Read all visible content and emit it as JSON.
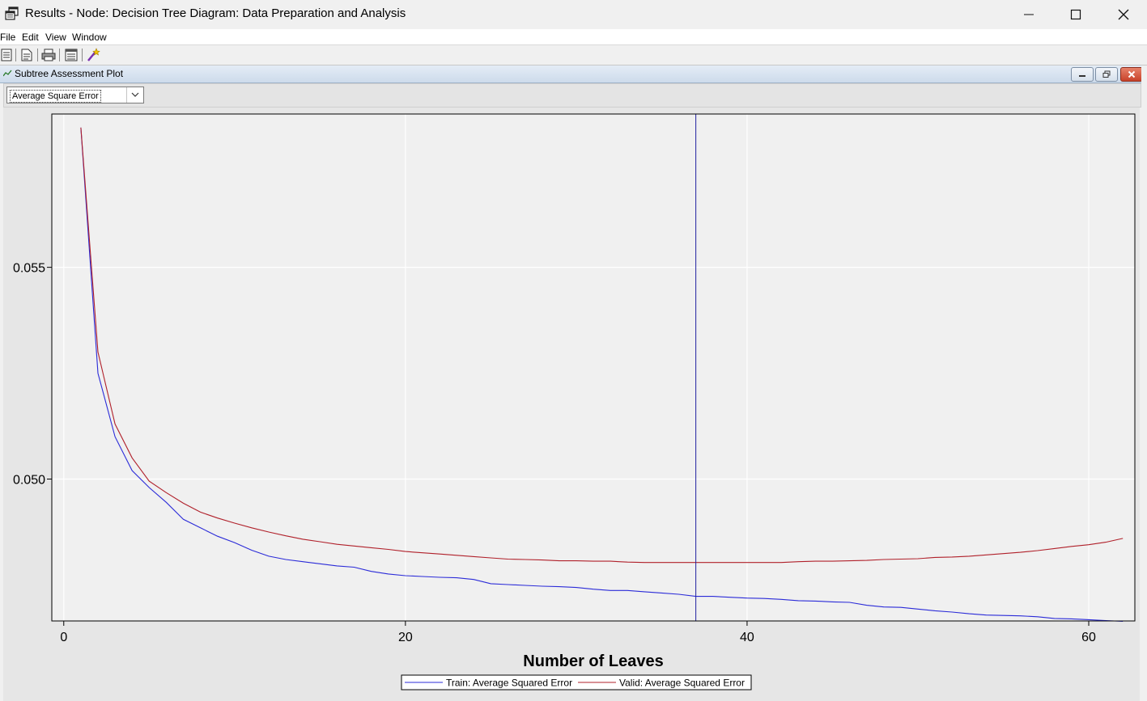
{
  "window": {
    "title": "Results - Node: Decision Tree  Diagram: Data Preparation and Analysis"
  },
  "menu": [
    "File",
    "Edit",
    "View",
    "Window"
  ],
  "toolbar": {
    "icons": [
      "document-icon",
      "report-icon",
      "print-icon",
      "table-icon",
      "wizard-icon"
    ]
  },
  "inner_window": {
    "title": "Subtree Assessment Plot"
  },
  "stat_selector": {
    "value": "Average Square Error"
  },
  "colors": {
    "train": "#2b2bd8",
    "valid": "#b0202a",
    "ref_line": "#2020a0",
    "plot_bg": "#f0f0f0"
  },
  "chart_data": {
    "type": "line",
    "xlabel": "Number of Leaves",
    "ylabel": "",
    "xlim": [
      -0.7,
      62.7
    ],
    "ylim": [
      0.04665,
      0.05862
    ],
    "xticks": [
      0,
      20,
      40,
      60
    ],
    "xtick_labels": [
      "0",
      "20",
      "40",
      "60"
    ],
    "yticks": [
      0.05,
      0.055
    ],
    "ytick_labels": [
      "0.050",
      "0.055"
    ],
    "grid": true,
    "selected_leaves": 37,
    "legend_position": "bottom-center",
    "series": [
      {
        "name": "Train: Average Squared Error",
        "color": "#2b2bd8",
        "x": [
          1,
          2,
          3,
          4,
          5,
          6,
          7,
          8,
          9,
          10,
          11,
          12,
          13,
          14,
          15,
          16,
          17,
          18,
          19,
          20,
          21,
          22,
          23,
          24,
          25,
          26,
          27,
          28,
          29,
          30,
          31,
          32,
          33,
          34,
          35,
          36,
          37,
          38,
          39,
          40,
          41,
          42,
          43,
          44,
          45,
          46,
          47,
          48,
          49,
          50,
          51,
          52,
          53,
          54,
          55,
          56,
          57,
          58,
          59,
          60,
          61,
          62
        ],
        "values": [
          0.0583,
          0.0525,
          0.051,
          0.0502,
          0.0498,
          0.04945,
          0.04905,
          0.04885,
          0.04865,
          0.0485,
          0.04832,
          0.04818,
          0.0481,
          0.04805,
          0.048,
          0.04795,
          0.04792,
          0.04782,
          0.04776,
          0.04772,
          0.0477,
          0.04768,
          0.04767,
          0.04763,
          0.04753,
          0.04751,
          0.04749,
          0.04747,
          0.04746,
          0.04744,
          0.0474,
          0.04737,
          0.04737,
          0.04734,
          0.04731,
          0.04728,
          0.04723,
          0.04723,
          0.04721,
          0.04719,
          0.04718,
          0.04716,
          0.04713,
          0.04712,
          0.0471,
          0.04709,
          0.04702,
          0.04698,
          0.04697,
          0.04693,
          0.04689,
          0.04686,
          0.04682,
          0.04679,
          0.04678,
          0.04677,
          0.04675,
          0.04671,
          0.0467,
          0.04668,
          0.04666,
          0.04664
        ]
      },
      {
        "name": "Valid: Average Squared Error",
        "color": "#b0202a",
        "x": [
          1,
          2,
          3,
          4,
          5,
          6,
          7,
          8,
          9,
          10,
          11,
          12,
          13,
          14,
          15,
          16,
          17,
          18,
          19,
          20,
          21,
          22,
          23,
          24,
          25,
          26,
          27,
          28,
          29,
          30,
          31,
          32,
          33,
          34,
          35,
          36,
          37,
          38,
          39,
          40,
          41,
          42,
          43,
          44,
          45,
          46,
          47,
          48,
          49,
          50,
          51,
          52,
          53,
          54,
          55,
          56,
          57,
          58,
          59,
          60,
          61,
          62
        ],
        "values": [
          0.0583,
          0.053,
          0.0513,
          0.0505,
          0.04995,
          0.04968,
          0.04943,
          0.04922,
          0.04908,
          0.04896,
          0.04885,
          0.04875,
          0.04866,
          0.04858,
          0.04852,
          0.04846,
          0.04842,
          0.04838,
          0.04834,
          0.04829,
          0.04826,
          0.04823,
          0.0482,
          0.04817,
          0.04814,
          0.04811,
          0.0481,
          0.04809,
          0.04807,
          0.04807,
          0.04806,
          0.04806,
          0.04804,
          0.04803,
          0.04803,
          0.04803,
          0.04803,
          0.04803,
          0.04803,
          0.04803,
          0.04803,
          0.04803,
          0.04805,
          0.04806,
          0.04806,
          0.04807,
          0.04808,
          0.0481,
          0.04811,
          0.04812,
          0.04815,
          0.04816,
          0.04818,
          0.04821,
          0.04824,
          0.04827,
          0.04831,
          0.04836,
          0.04841,
          0.04845,
          0.04851,
          0.0486
        ]
      }
    ]
  }
}
